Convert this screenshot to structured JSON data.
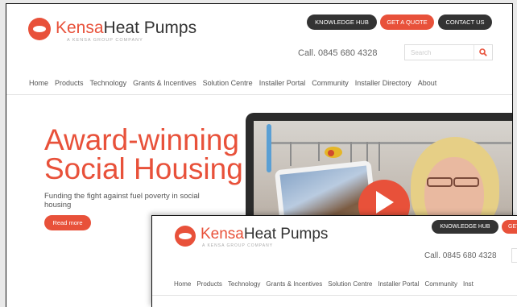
{
  "brand": {
    "name_colored": "Kensa",
    "name_rest": "Heat Pumps",
    "tagline": "A KENSA GROUP COMPANY",
    "accent_color": "#e8513a"
  },
  "header": {
    "buttons": [
      "KNOWLEDGE HUB",
      "GET A QUOTE",
      "CONTACT US"
    ],
    "phone": "Call. 0845 680 4328",
    "search_placeholder": "Search",
    "search_icon": "magnifier-icon"
  },
  "nav": {
    "items": [
      "Home",
      "Products",
      "Technology",
      "Grants & Incentives",
      "Solution Centre",
      "Installer Portal",
      "Community",
      "Installer Directory",
      "About"
    ]
  },
  "hero": {
    "title_line1": "Award-winning",
    "title_line2": "Social Housing",
    "subtitle": "Funding the fight against fuel poverty in social housing",
    "cta": "Read more",
    "media_icon": "play-icon"
  },
  "inset": {
    "buttons": [
      "KNOWLEDGE HUB",
      "GET"
    ],
    "phone": "Call. 0845 680 4328",
    "nav_items": [
      "Home",
      "Products",
      "Technology",
      "Grants & Incentives",
      "Solution Centre",
      "Installer Portal",
      "Community",
      "Inst"
    ]
  }
}
